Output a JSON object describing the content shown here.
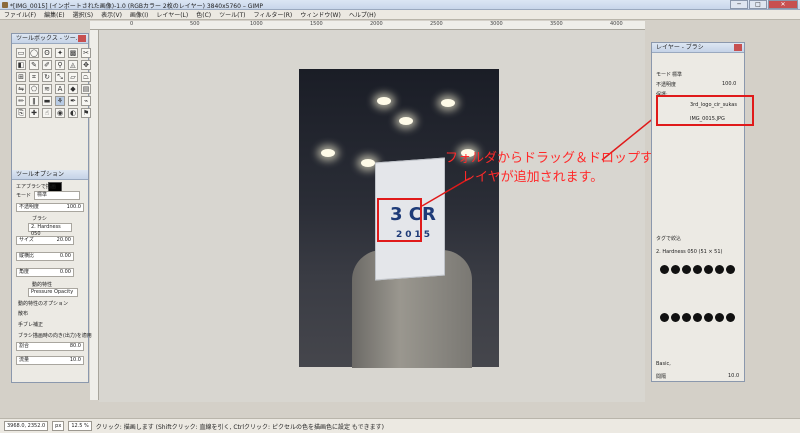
{
  "window": {
    "title": "*[IMG_0015] (インポートされた画像)-1.0 (RGBカラー 2枚のレイヤー) 3840x5760 – GIMP",
    "minimize": "─",
    "maximize": "□",
    "close": "✕"
  },
  "menu": [
    "ファイル(F)",
    "編集(E)",
    "選択(S)",
    "表示(V)",
    "画像(I)",
    "レイヤー(L)",
    "色(C)",
    "ツール(T)",
    "フィルター(R)",
    "ウィンドウ(W)",
    "ヘルプ(H)"
  ],
  "ruler": [
    "0",
    "500",
    "1000",
    "1500",
    "2000",
    "2500",
    "3000",
    "3500",
    "4000"
  ],
  "toolbox": {
    "title": "ツールボックス - ツー...",
    "options_title": "ツールオプション",
    "tool_name": "エアブラシで描画",
    "mode_label": "モード",
    "mode_value": "標準",
    "opacity_label": "不透明度",
    "opacity_value": "100.0",
    "brush_label": "ブラシ",
    "brush_value": "2. Hardness 050",
    "size_label": "サイズ",
    "size_value": "20.00",
    "aspect_label": "縦横比",
    "aspect_value": "0.00",
    "angle_label": "角度",
    "angle_value": "0.00",
    "dynamics_label": "動的特性",
    "dynamics_value": "Pressure Opacity",
    "dynamics_options": "動的特性のオプション",
    "jitter": "散布",
    "smooth": "手ブレ補正",
    "apply_jitter": "ブラシ描画時の向き(出力)を適用",
    "rate_label": "割合",
    "rate_value": "80.0",
    "flow_label": "流量",
    "flow_value": "10.0"
  },
  "canvas": {
    "annotation_line1": "フォルダからドラッグ＆ドロップするだけで、",
    "annotation_line2": "レイヤが追加されます。",
    "logo_text": "3 CR",
    "logo_year": "2015"
  },
  "layers": {
    "title": "レイヤー - ブラシ",
    "mode_label": "モード",
    "mode_value": "標準",
    "opacity_label": "不透明度",
    "opacity_value": "100.0",
    "lock_label": "保護:",
    "items": [
      {
        "name": "3rd_logo_cir_sukas"
      },
      {
        "name": "IMG_0015.JPG"
      }
    ]
  },
  "brushes": {
    "filter_placeholder": "タグで絞込",
    "current": "2. Hardness 050 (51 × 51)",
    "tag_value": "Basic,",
    "spacing_label": "間隔",
    "spacing_value": "10.0"
  },
  "status": {
    "coords": "3968.0, 2352.0",
    "unit": "px",
    "zoom": "12.5 %",
    "message": "クリック: 描画します (Shiftクリック: 直線を引く, Ctrlクリック: ピクセルの色を描画色に設定 もできます)"
  }
}
